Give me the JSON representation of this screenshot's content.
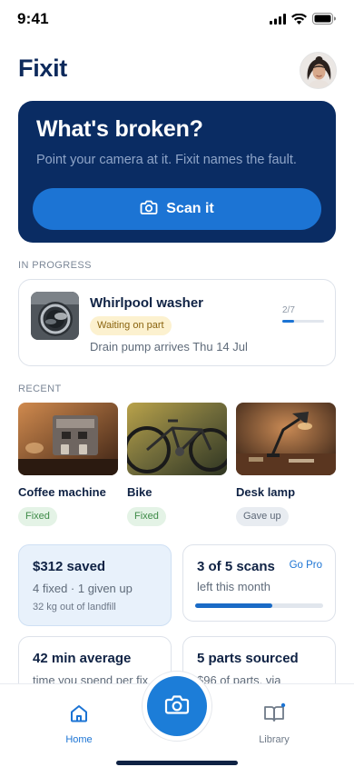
{
  "status_bar": {
    "time": "9:41"
  },
  "header": {
    "title": "Fixit"
  },
  "hero": {
    "title": "What's broken?",
    "subtitle": "Point your camera at it. Fixit names the fault.",
    "button_label": "Scan it"
  },
  "in_progress": {
    "section_label": "IN PROGRESS",
    "title": "Whirlpool washer",
    "status": "Waiting on part",
    "note": "Drain pump arrives Thu 14 Jul",
    "step": "2/7",
    "progress": 0.2857
  },
  "recent": {
    "section_label": "RECENT",
    "items": [
      {
        "name": "Coffee machine",
        "status": "Fixed"
      },
      {
        "name": "Bike",
        "status": "Fixed"
      },
      {
        "name": "Desk lamp",
        "status": "Gave up"
      }
    ]
  },
  "stats": {
    "saved": {
      "title": "$312 saved",
      "line": "4 fixed · 1 given up",
      "small": "32 kg out of landfill"
    },
    "scans": {
      "title": "3 of 5 scans",
      "link": "Go Pro",
      "line": "left this month",
      "progress": 0.6
    },
    "average": {
      "title": "42 min average",
      "line": "time you spend per fix"
    },
    "parts": {
      "title": "5 parts sourced",
      "line": "$96 of parts, via"
    }
  },
  "tab_bar": {
    "home_label": "Home",
    "library_label": "Library"
  },
  "colors": {
    "hero_bg": "#0a2c63",
    "accent": "#1c74d4",
    "text_primary": "#0f2244"
  }
}
